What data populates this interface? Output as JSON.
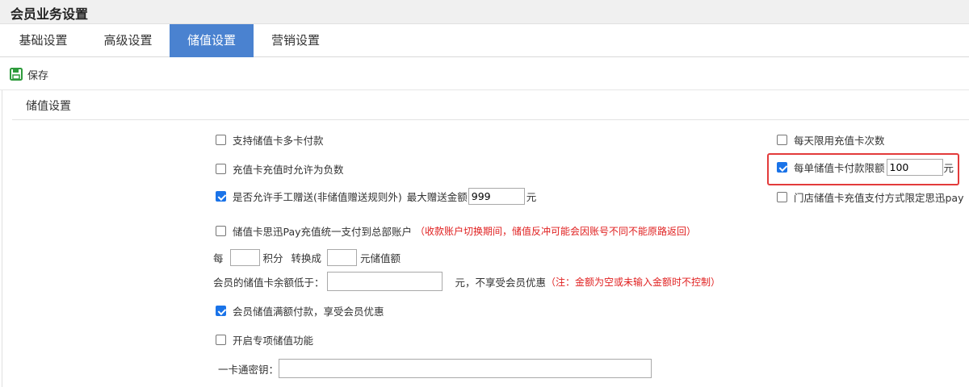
{
  "window": {
    "title": "会员业务设置"
  },
  "tabs": [
    {
      "label": "基础设置",
      "active": false
    },
    {
      "label": "高级设置",
      "active": false
    },
    {
      "label": "储值设置",
      "active": true
    },
    {
      "label": "营销设置",
      "active": false
    }
  ],
  "toolbar": {
    "save_label": "保存",
    "save_icon": "floppy-disk-icon",
    "icon_color": "#2e9b3c"
  },
  "section": {
    "title": "储值设置"
  },
  "settings": {
    "multi_card_pay": {
      "label": "支持储值卡多卡付款",
      "checked": false
    },
    "allow_negative": {
      "label": "充值卡充值时允许为负数",
      "checked": false
    },
    "manual_gift": {
      "label": "是否允许手工赠送(非储值赠送规则外)",
      "max_label": "最大赠送金额",
      "max_value": "999",
      "unit": "元",
      "checked": true
    },
    "pay_unified": {
      "label": "储值卡思迅Pay充值统一支付到总部账户",
      "note": "（收款账户切换期间，储值反冲可能会因账号不同不能原路返回）",
      "checked": false
    },
    "points_convert": {
      "prefix": "每",
      "points_value": "",
      "points_label": "积分",
      "convert_label": "转换成",
      "amount_value": "",
      "suffix": "元储值额"
    },
    "low_balance": {
      "label": "会员的储值卡余额低于：",
      "value": "",
      "suffix": "元，不享受会员优惠",
      "note": "（注：金额为空或未输入金额时不控制）"
    },
    "full_pay_discount": {
      "label": "会员储值满额付款，享受会员优惠",
      "checked": true
    },
    "special_stored": {
      "label": "开启专项储值功能",
      "checked": false
    },
    "card_key": {
      "label": "一卡通密钥：",
      "value": ""
    },
    "daily_limit": {
      "label": "每天限用充值卡次数",
      "checked": false
    },
    "per_order_limit": {
      "label": "每单储值卡付款限额",
      "value": "100",
      "unit": "元",
      "checked": true
    },
    "store_pay_limit": {
      "label": "门店储值卡充值支付方式限定思迅pay",
      "checked": false
    }
  },
  "colors": {
    "tab_active": "#4a82d0",
    "checkbox_checked": "#1a73e8",
    "highlight": "#e33b3b",
    "note_red": "#e02020"
  }
}
